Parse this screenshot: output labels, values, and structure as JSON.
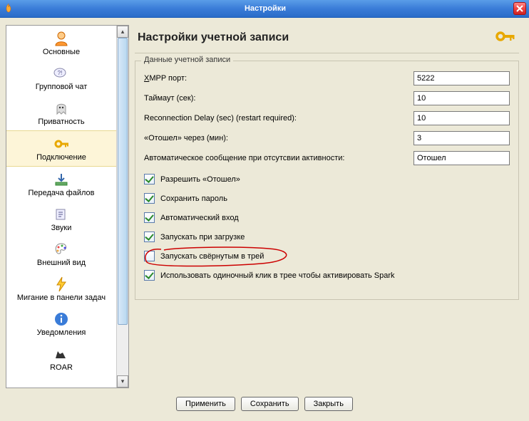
{
  "window": {
    "title": "Настройки"
  },
  "sidebar": {
    "items": [
      {
        "label": "Основные"
      },
      {
        "label": "Групповой чат"
      },
      {
        "label": "Приватность"
      },
      {
        "label": "Подключение"
      },
      {
        "label": "Передача файлов"
      },
      {
        "label": "Звуки"
      },
      {
        "label": "Внешний вид"
      },
      {
        "label": "Мигание в панели задач"
      },
      {
        "label": "Уведомления"
      },
      {
        "label": "ROAR"
      }
    ]
  },
  "main": {
    "title": "Настройки учетной записи",
    "legend": "Данные учетной записи",
    "fields": {
      "xmpp_port": {
        "label_pre": "X",
        "label_post": "MPP порт:",
        "value": "5222"
      },
      "timeout": {
        "label": "Таймаут (сек):",
        "value": "10"
      },
      "recon": {
        "label": "Reconnection Delay (sec) (restart required):",
        "value": "10"
      },
      "away": {
        "label": "«Отошел» через (мин):",
        "value": "3"
      },
      "automsg": {
        "label": "Автоматическое сообщение при отсутсвии активности:",
        "value": "Отошел"
      }
    },
    "checks": [
      {
        "label": "Разрешить «Отошел»",
        "checked": true
      },
      {
        "label": "Сохранить пароль",
        "checked": true
      },
      {
        "label": "Автоматический вход",
        "checked": true
      },
      {
        "label": "Запускать при загрузке",
        "checked": true
      },
      {
        "label": "Запускать свёрнутым в трей",
        "checked": false,
        "highlight": true
      },
      {
        "label": "Использовать одиночный клик в трее чтобы активировать Spark",
        "checked": true
      }
    ]
  },
  "buttons": {
    "apply": "Применить",
    "save": "Сохранить",
    "close": "Закрыть"
  }
}
